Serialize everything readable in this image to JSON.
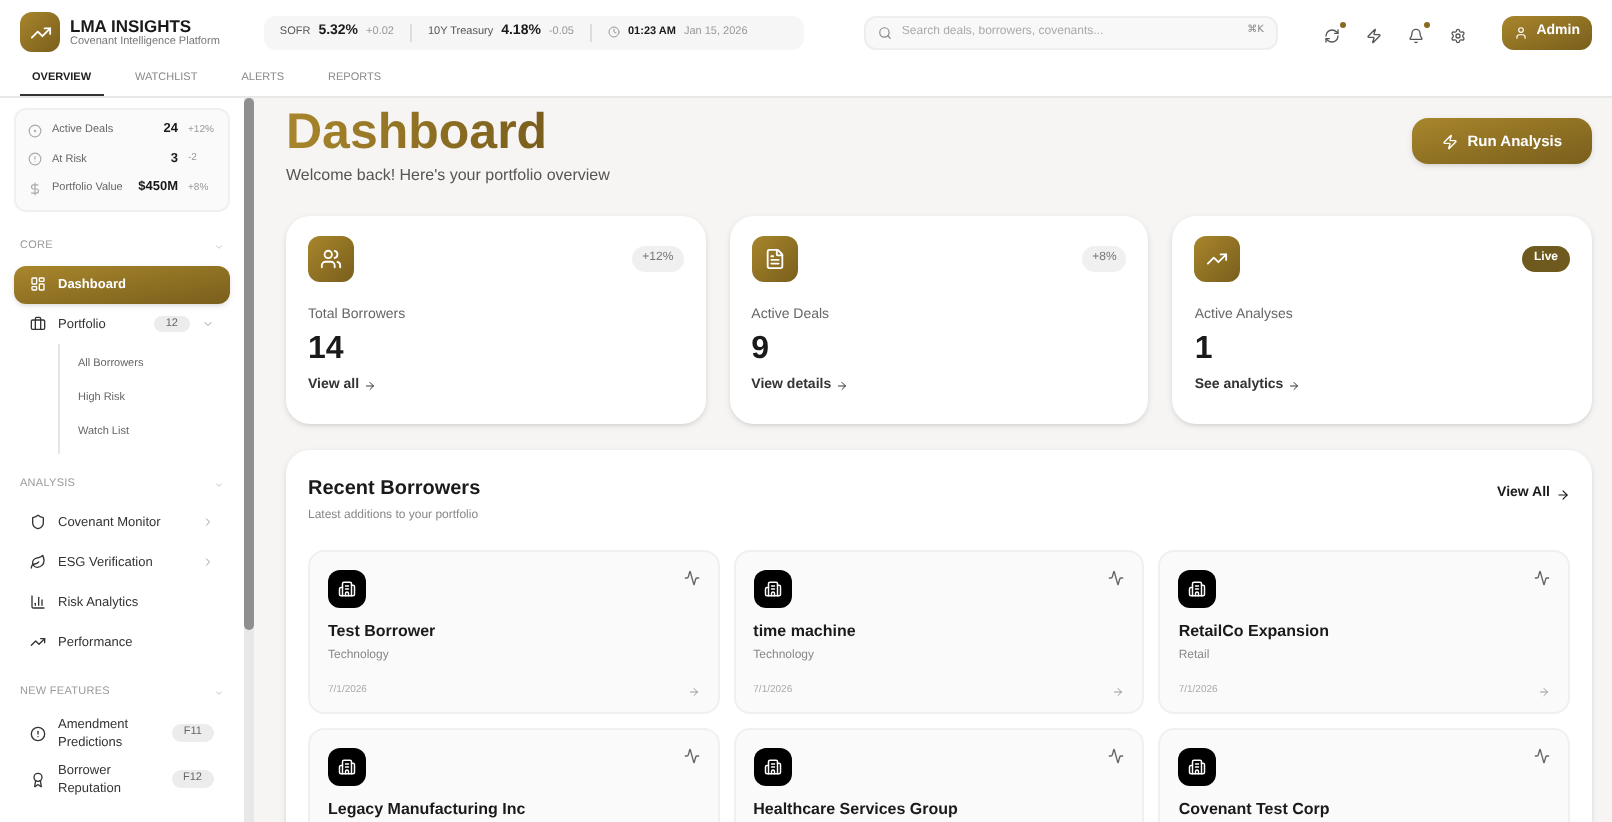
{
  "brand": {
    "title": "LMA INSIGHTS",
    "subtitle": "Covenant Intelligence Platform"
  },
  "market": [
    {
      "label": "SOFR",
      "value": "5.32%",
      "change": "+0.02"
    },
    {
      "label": "10Y Treasury",
      "value": "4.18%",
      "change": "-0.05"
    }
  ],
  "clock": {
    "time": "01:23 AM",
    "date": "Jan 15, 2026"
  },
  "search": {
    "placeholder": "Search deals, borrowers, covenants...",
    "shortcut": "⌘K"
  },
  "header_icons": [
    {
      "dot": true
    },
    {
      "dot": false
    },
    {
      "dot": true
    },
    {
      "dot": false
    }
  ],
  "user": {
    "label": "Admin"
  },
  "tabs": [
    {
      "label": "OVERVIEW",
      "selected": true
    },
    {
      "label": "WATCHLIST",
      "selected": false
    },
    {
      "label": "ALERTS",
      "selected": false
    },
    {
      "label": "REPORTS",
      "selected": false
    }
  ],
  "stats": [
    {
      "label": "Active Deals",
      "value": "24",
      "change": "+12%"
    },
    {
      "label": "At Risk",
      "value": "3",
      "change": "-2"
    },
    {
      "label": "Portfolio Value",
      "value": "$450M",
      "change": "+8%"
    }
  ],
  "sidebar": [
    {
      "title": "CORE",
      "expanded": true,
      "items": [
        {
          "label": "Dashboard",
          "selected": true
        },
        {
          "label": "Portfolio",
          "selected": false,
          "badge": "12",
          "expanded": true,
          "children": [
            {
              "label": "All Borrowers"
            },
            {
              "label": "High Risk"
            },
            {
              "label": "Watch List"
            }
          ]
        }
      ]
    },
    {
      "title": "ANALYSIS",
      "expanded": true,
      "items": [
        {
          "label": "Covenant Monitor",
          "selected": false,
          "expanded": false
        },
        {
          "label": "ESG Verification",
          "selected": false,
          "expanded": false
        },
        {
          "label": "Risk Analytics",
          "selected": false
        },
        {
          "label": "Performance",
          "selected": false
        }
      ]
    },
    {
      "title": "NEW FEATURES",
      "expanded": true,
      "items": [
        {
          "label": "Amendment Predictions",
          "selected": false,
          "badge": "F11"
        },
        {
          "label": "Borrower Reputation",
          "selected": false,
          "badge": "F12"
        }
      ]
    }
  ],
  "page": {
    "title": "Dashboard",
    "subtitle": "Welcome back! Here's your portfolio overview",
    "action": "Run Analysis"
  },
  "cards": [
    {
      "label": "Total Borrowers",
      "value": "14",
      "link": "View all",
      "badge": "+12%",
      "kind": "change"
    },
    {
      "label": "Active Deals",
      "value": "9",
      "link": "View details",
      "badge": "+8%",
      "kind": "change"
    },
    {
      "label": "Active Analyses",
      "value": "1",
      "link": "See analytics",
      "badge": "Live",
      "kind": "live"
    }
  ],
  "recent": {
    "title": "Recent Borrowers",
    "subtitle": "Latest additions to your portfolio",
    "link": "View All",
    "borrowers": [
      {
        "name": "Test Borrower",
        "industry": "Technology",
        "date": "7/1/2026"
      },
      {
        "name": "time machine",
        "industry": "Technology",
        "date": "7/1/2026"
      },
      {
        "name": "RetailCo Expansion",
        "industry": "Retail",
        "date": "7/1/2026"
      },
      {
        "name": "Legacy Manufacturing Inc"
      },
      {
        "name": "Healthcare Services Group"
      },
      {
        "name": "Covenant Test Corp"
      }
    ]
  }
}
